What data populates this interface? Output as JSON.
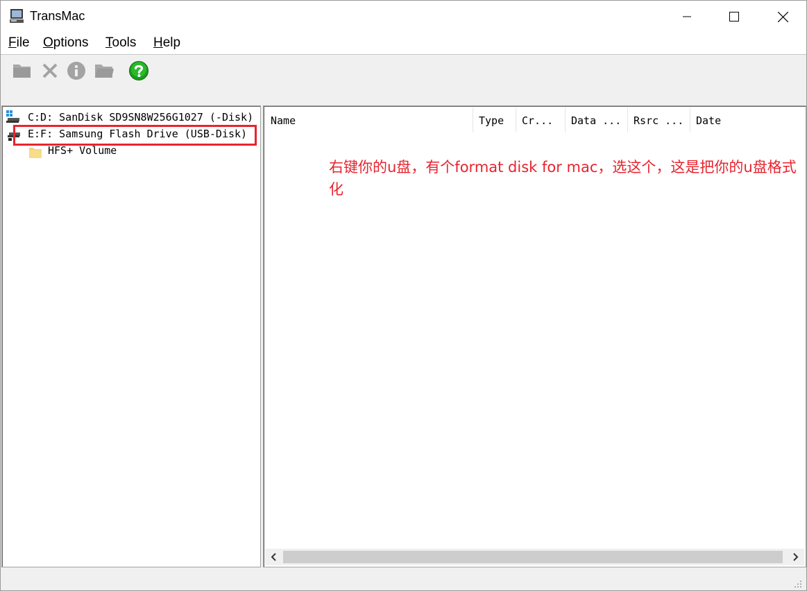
{
  "window": {
    "title": "TransMac"
  },
  "menu": [
    {
      "label": "File",
      "mnemonic": "F",
      "rest": "ile"
    },
    {
      "label": "Options",
      "mnemonic": "O",
      "rest": "ptions"
    },
    {
      "label": "Tools",
      "mnemonic": "T",
      "rest": "ools"
    },
    {
      "label": "Help",
      "mnemonic": "H",
      "rest": "elp"
    }
  ],
  "toolbar": {
    "icons": [
      "folder-icon",
      "delete-x-icon",
      "info-icon",
      "folder-open-icon",
      "help-icon"
    ],
    "help_color": "#1a9c1a"
  },
  "tree": {
    "items": [
      {
        "label": "C:D: SanDisk SD9SN8W256G1027 (-Disk)"
      },
      {
        "label": "E:F: Samsung Flash Drive (USB-Disk)"
      },
      {
        "label": "HFS+ Volume"
      }
    ]
  },
  "list": {
    "columns": [
      "Name",
      "Type",
      "Cr...",
      "Data ...",
      "Rsrc ...",
      "Date"
    ]
  },
  "annotation": {
    "text": "右键你的u盘，有个format disk for mac，选这个，这是把你的u盘格式化",
    "color": "#e8232e"
  }
}
